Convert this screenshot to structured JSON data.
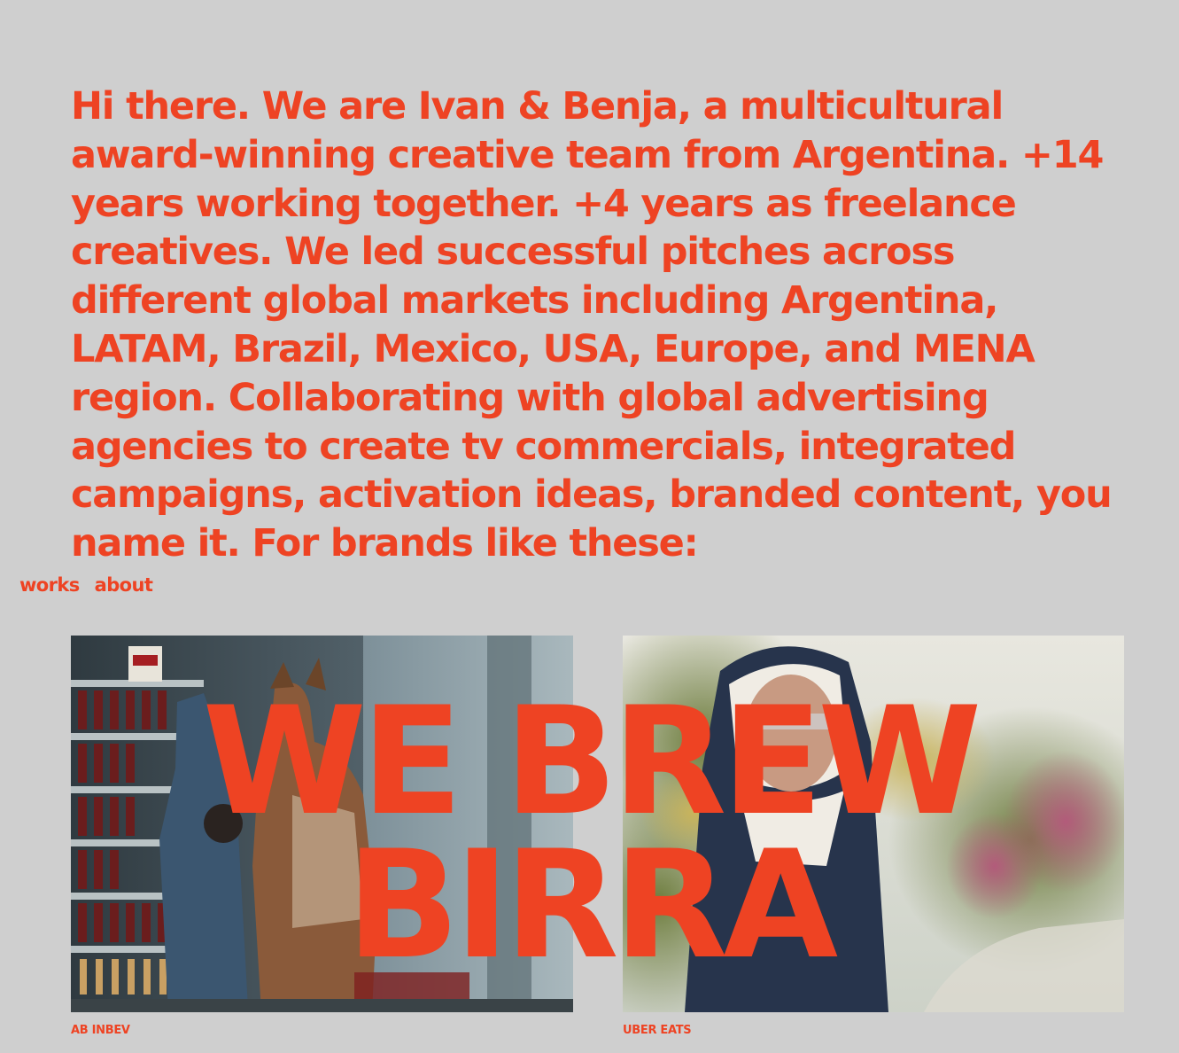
{
  "intro": {
    "text": "Hi there. We are Ivan & Benja, a multicultural award-winning creative team from Argentina. +14 years working together. +4 years as freelance creatives. We led successful pitches across different global markets including Argentina, LATAM, Brazil, Mexico, USA, Europe, and MENA region. Collaborating with global advertising agencies to create tv commercials, integrated campaigns, activation ideas, branded content, you name it. For brands like these:"
  },
  "nav": {
    "works_label": "works",
    "about_label": "about"
  },
  "projects": [
    {
      "client": "AB INBEV"
    },
    {
      "client": "UBER EATS"
    }
  ],
  "overlay": {
    "line1": "WE BREW",
    "line2": "BIRRA"
  },
  "colors": {
    "accent": "#ee4323",
    "background": "#cfcfcf"
  }
}
